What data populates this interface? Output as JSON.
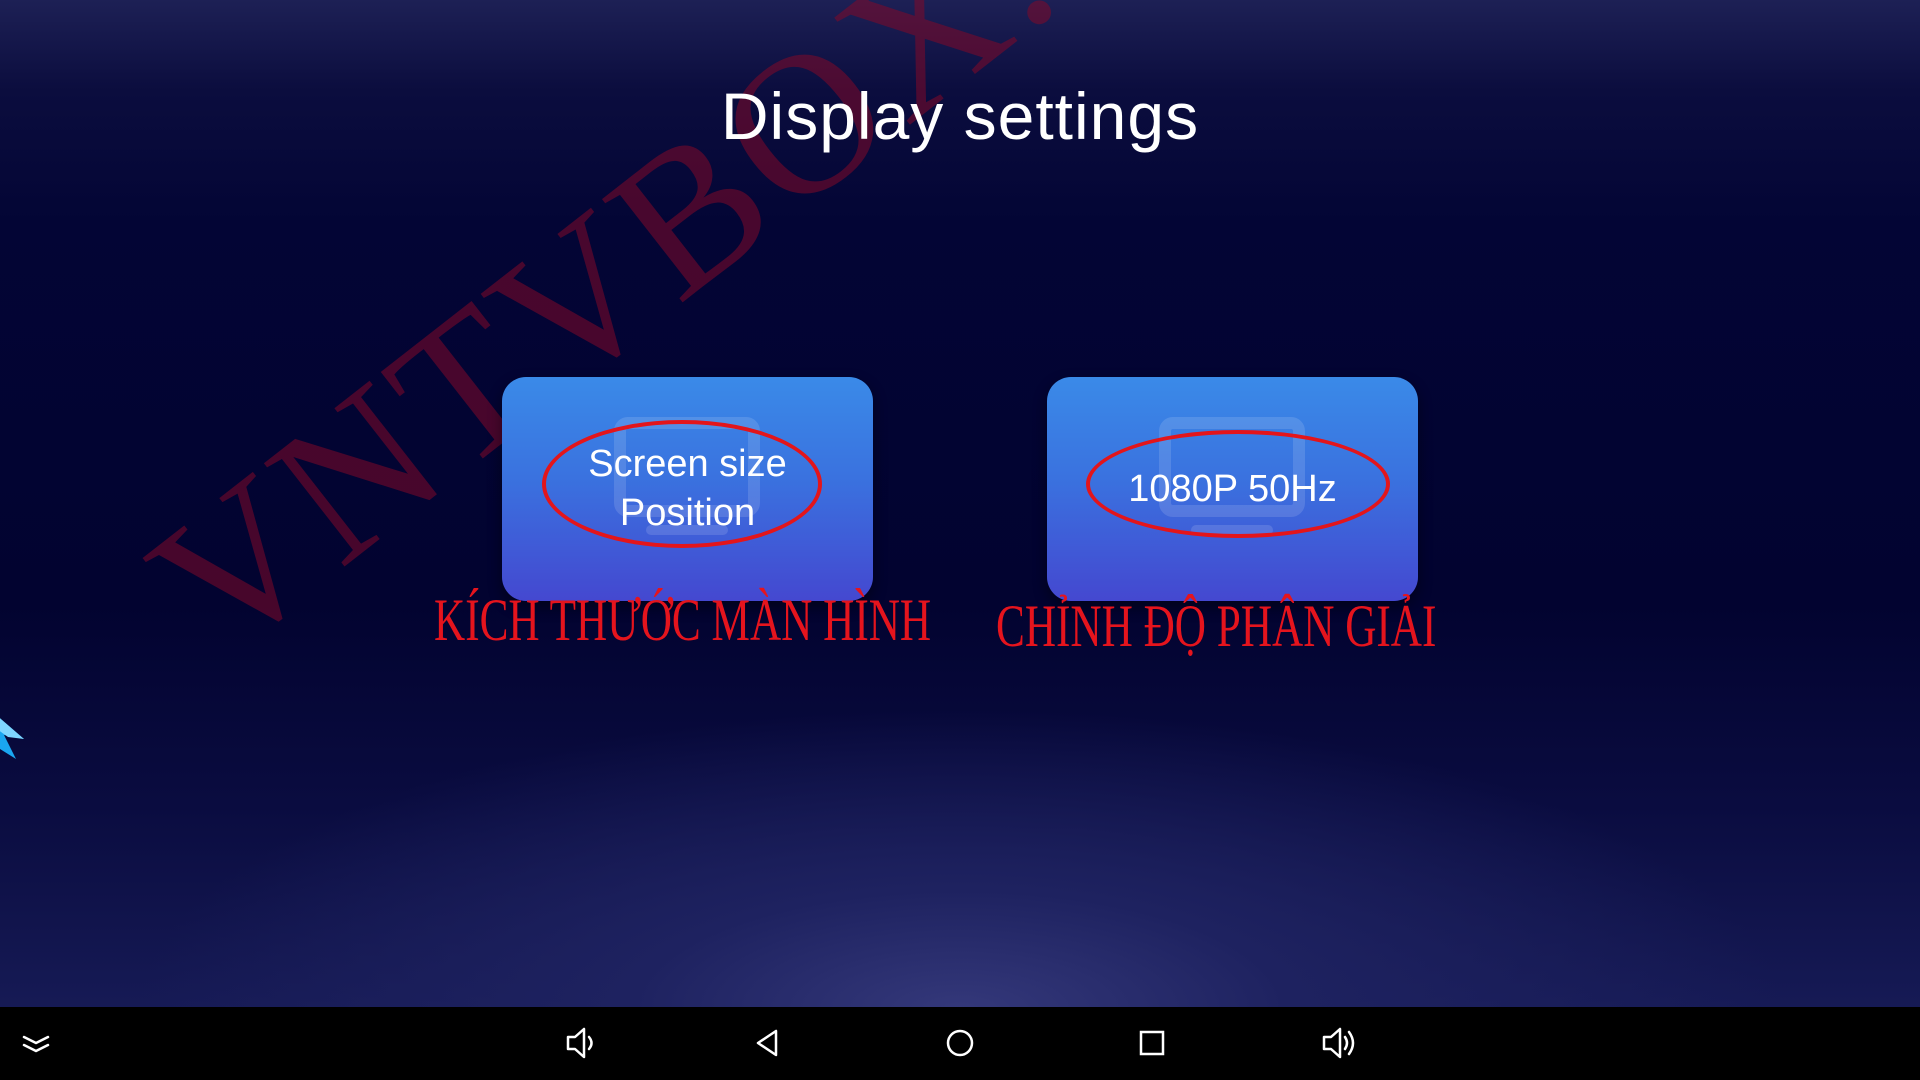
{
  "page": {
    "title": "Display settings"
  },
  "tiles": [
    {
      "lines": [
        "Screen size",
        "Position"
      ],
      "icon": "monitor-icon"
    },
    {
      "lines": [
        "1080P 50Hz"
      ],
      "icon": "monitor-icon"
    }
  ],
  "annotations": {
    "screen_size": "KÍCH THƯỚC MÀN HÌNH",
    "resolution": "CHỈNH ĐỘ PHÂN GIẢI",
    "watermark": "VNTVBOX.COM",
    "color": "#e5141d"
  },
  "navbar": {
    "items": [
      "hide-bar-icon",
      "volume-down-icon",
      "back-icon",
      "home-icon",
      "recents-icon",
      "volume-up-icon"
    ]
  },
  "colors": {
    "background": "#020330",
    "tile": "#3a7ae2",
    "navbar": "#000000"
  }
}
